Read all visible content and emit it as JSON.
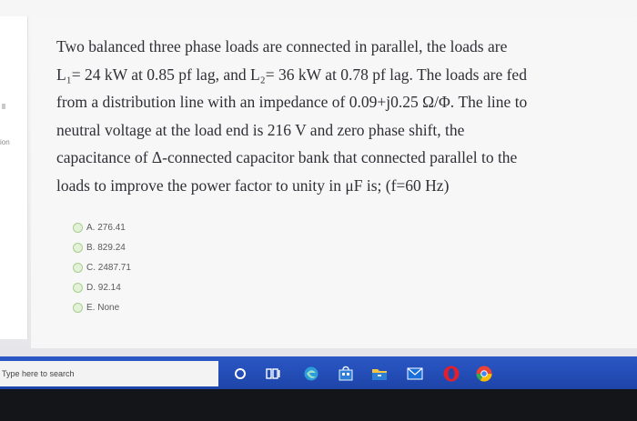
{
  "sidebar": {
    "label": "ion"
  },
  "question": {
    "lines": [
      "Two balanced three phase loads are connected in parallel, the loads are",
      "L₁= 24 kW at 0.85 pf lag, and L₂= 36 kW at 0.78 pf lag. The loads are fed",
      "from a distribution line with an impedance of 0.09+j0.25 Ω/Φ. The line to",
      "neutral voltage at the load end is 216 V and zero phase shift, the",
      "capacitance of Δ-connected capacitor bank that connected parallel to the",
      "loads to improve the power factor to unity in μF is; (f=60 Hz)"
    ]
  },
  "options": [
    {
      "label": "A. 276.41"
    },
    {
      "label": "B. 829.24"
    },
    {
      "label": "C. 2487.71"
    },
    {
      "label": "D. 92.14"
    },
    {
      "label": "E. None"
    }
  ],
  "taskbar": {
    "search_placeholder": "Type here to search",
    "icons": [
      "cortana-icon",
      "task-view-icon",
      "edge-icon",
      "store-icon",
      "file-explorer-icon",
      "mail-icon",
      "opera-icon",
      "chrome-icon"
    ]
  },
  "colors": {
    "taskbar": "#2450bb",
    "radio_border": "#a6cf8e",
    "question_text": "#2f2f36"
  }
}
